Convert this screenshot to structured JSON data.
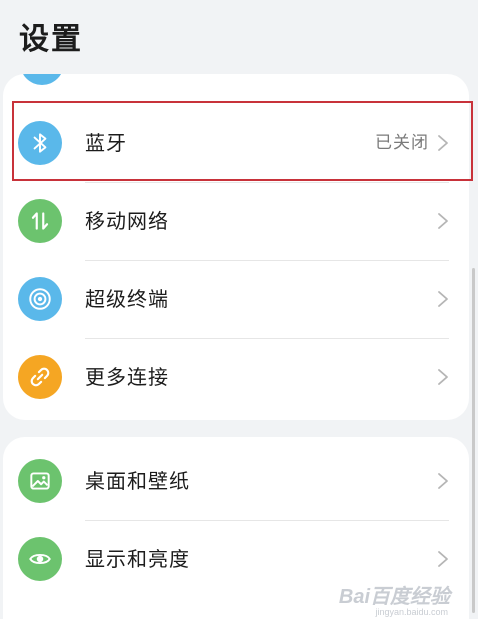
{
  "header": {
    "title": "设置"
  },
  "colors": {
    "bluetooth": "#5ab8ea",
    "mobile_network": "#6cc36e",
    "super_device": "#5ab8ea",
    "more_connections": "#f5a623",
    "wallpaper": "#6cc36e",
    "display": "#6cc36e",
    "highlight_border": "#c8323a"
  },
  "connections": {
    "items": [
      {
        "label": "蓝牙",
        "value": "已关闭",
        "icon": "bluetooth-icon"
      },
      {
        "label": "移动网络",
        "value": "",
        "icon": "mobile-data-icon"
      },
      {
        "label": "超级终端",
        "value": "",
        "icon": "super-device-icon"
      },
      {
        "label": "更多连接",
        "value": "",
        "icon": "link-icon"
      }
    ]
  },
  "personalization": {
    "items": [
      {
        "label": "桌面和壁纸",
        "value": "",
        "icon": "wallpaper-icon"
      },
      {
        "label": "显示和亮度",
        "value": "",
        "icon": "eye-icon"
      }
    ]
  },
  "watermark": {
    "main": "Bai百度经验",
    "sub": "jingyan.baidu.com"
  }
}
